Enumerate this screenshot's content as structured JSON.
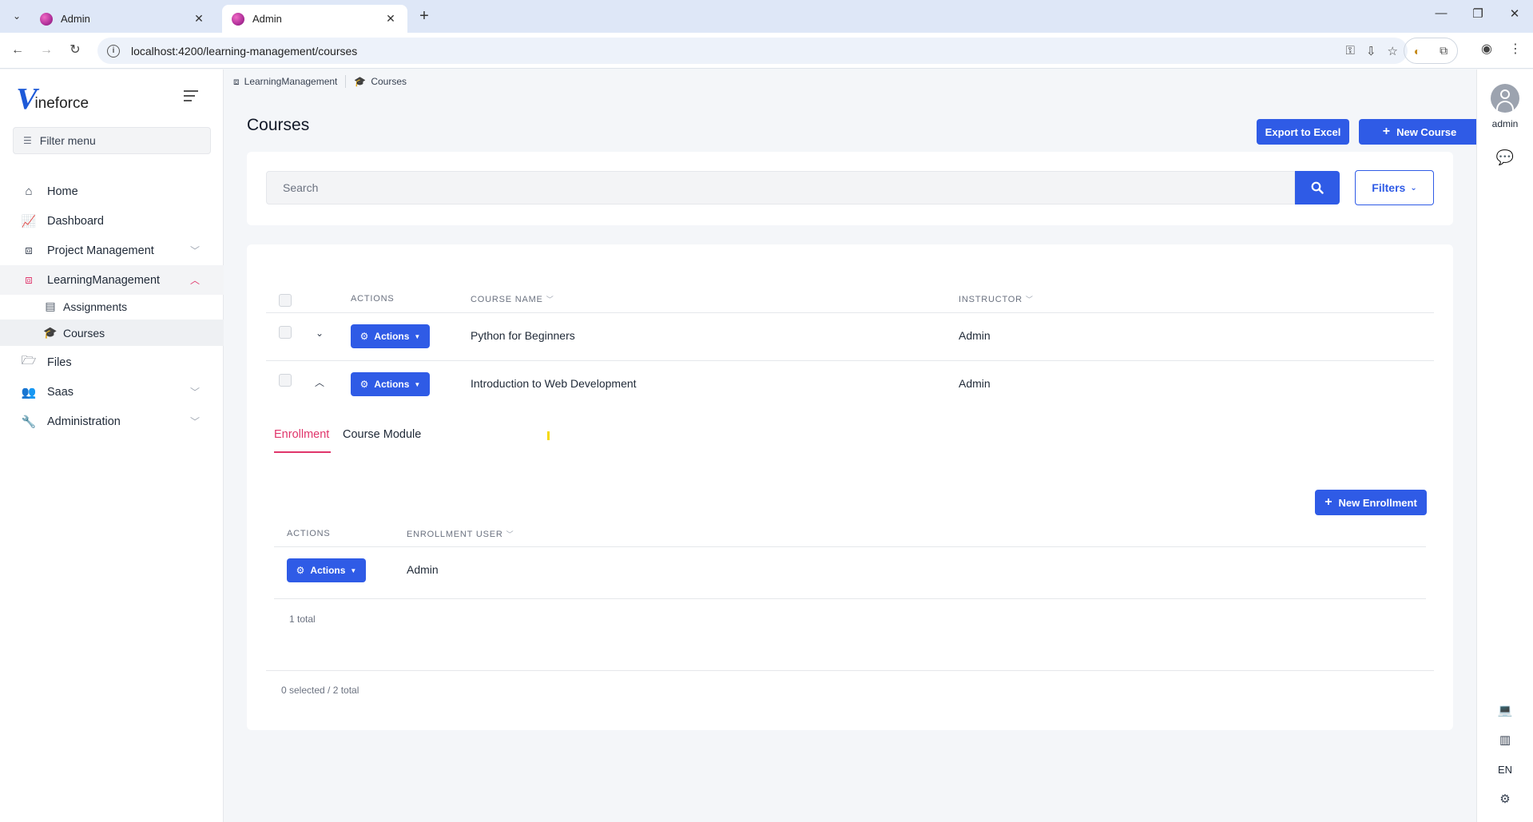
{
  "browser": {
    "tabs": [
      {
        "title": "Admin",
        "active": false
      },
      {
        "title": "Admin",
        "active": true
      }
    ],
    "url": "localhost:4200/learning-management/courses"
  },
  "sidebar": {
    "logo_text": "ineforce",
    "filter_placeholder": "Filter menu",
    "items": [
      {
        "label": "Home",
        "icon": "home-icon"
      },
      {
        "label": "Dashboard",
        "icon": "chart-icon"
      },
      {
        "label": "Project Management",
        "icon": "sitemap-icon",
        "expandable": true
      },
      {
        "label": "LearningManagement",
        "icon": "sitemap-icon",
        "expandable": true,
        "open": true,
        "children": [
          {
            "label": "Assignments",
            "icon": "file-icon"
          },
          {
            "label": "Courses",
            "icon": "graduation-cap-icon",
            "active": true
          }
        ]
      },
      {
        "label": "Files",
        "icon": "folder-icon"
      },
      {
        "label": "Saas",
        "icon": "users-icon",
        "expandable": true
      },
      {
        "label": "Administration",
        "icon": "wrench-icon",
        "expandable": true
      }
    ]
  },
  "breadcrumb": [
    "LearningManagement",
    "Courses"
  ],
  "page": {
    "title": "Courses",
    "export_label": "Export to Excel",
    "new_course_label": "New Course"
  },
  "search": {
    "placeholder": "Search",
    "filters_label": "Filters"
  },
  "courses_table": {
    "headers": {
      "actions": "ACTIONS",
      "course_name": "COURSE NAME",
      "instructor": "INSTRUCTOR"
    },
    "rows": [
      {
        "actions_label": "Actions",
        "course_name": "Python for Beginners",
        "instructor": "Admin",
        "expanded": false
      },
      {
        "actions_label": "Actions",
        "course_name": "Introduction to Web Development",
        "instructor": "Admin",
        "expanded": true
      }
    ],
    "footer": "0 selected / 2 total"
  },
  "detail": {
    "tabs": [
      "Enrollment",
      "Course Module"
    ],
    "active_tab": "Enrollment",
    "new_enrollment_label": "New Enrollment",
    "headers": {
      "actions": "ACTIONS",
      "enrollment_user": "ENROLLMENT USER"
    },
    "rows": [
      {
        "actions_label": "Actions",
        "enrollment_user": "Admin"
      }
    ],
    "footer": "1 total"
  },
  "rightrail": {
    "user": "admin",
    "language": "EN"
  },
  "colors": {
    "primary": "#2f5be6",
    "accent": "#e0356b",
    "marker": "#f5d90a"
  }
}
